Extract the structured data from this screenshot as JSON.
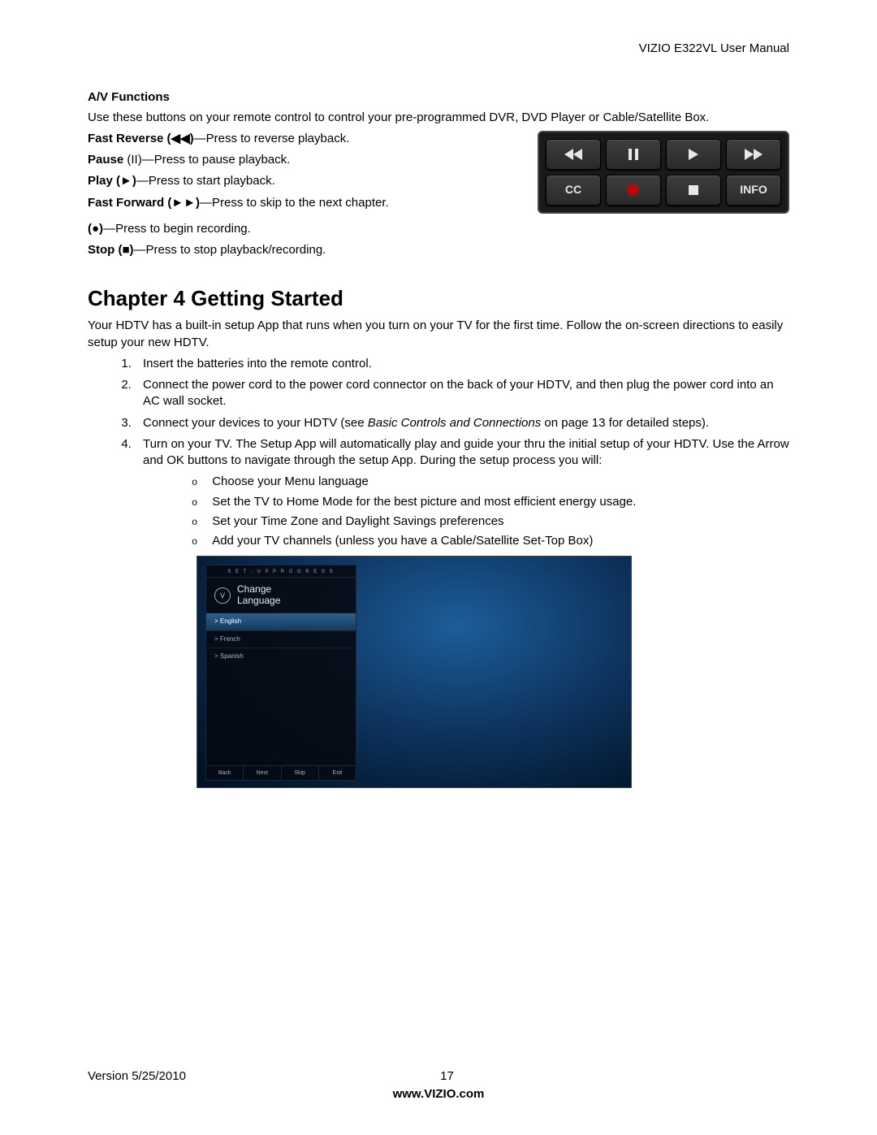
{
  "doc_title": "VIZIO E322VL User Manual",
  "av": {
    "heading": "A/V Functions",
    "intro": "Use these buttons on your remote control to control your pre-programmed DVR, DVD Player or Cable/Satellite Box.",
    "items": {
      "fr_label": "Fast Reverse (◀◀)",
      "fr_desc": "—Press to reverse playback.",
      "pause_label": "Pause",
      "pause_sym": " (II)",
      "pause_desc": "—Press to pause playback.",
      "play_label": "Play (►)",
      "play_desc": "—Press to start playback.",
      "ff_label": "Fast Forward (►►)",
      "ff_desc": "—Press to skip to the next chapter.",
      "rec_label": "(●)",
      "rec_desc": "—Press to begin recording.",
      "stop_label": "Stop (■)",
      "stop_desc": "—Press to stop playback/recording."
    }
  },
  "remote": {
    "cc": "CC",
    "info": "INFO"
  },
  "chapter": {
    "title": "Chapter 4 Getting Started",
    "intro": "Your HDTV has a built-in setup App that runs when you turn on your TV for the first time. Follow the on-screen directions to easily setup your new HDTV.",
    "steps": [
      "Insert the batteries into the remote control.",
      "Connect the power cord to the power cord connector on the back of your HDTV, and then plug the power cord into an AC wall socket.",
      "",
      "Turn on your TV. The Setup App will automatically play and guide your thru the initial setup of your HDTV. Use the Arrow and OK buttons to navigate through the setup App. During the setup process you will:"
    ],
    "step3_pre": "Connect your devices to your HDTV (see ",
    "step3_ref": "Basic Controls and Connections",
    "step3_post": " on page 13 for detailed steps).",
    "substeps": [
      "Choose your Menu language",
      "Set the TV to Home Mode for the best picture and most efficient energy usage.",
      "Set your Time Zone and Daylight Savings preferences",
      "Add your TV channels (unless you have a Cable/Satellite Set-Top Box)"
    ]
  },
  "setup_screenshot": {
    "progress_label": "S E T - U P   P R O G R E S S",
    "title_line1": "Change",
    "title_line2": "Language",
    "langs": {
      "en": "> English",
      "fr": "> French",
      "es": "> Spanish"
    },
    "footer": {
      "back": "Back",
      "next": "Next",
      "skip": "Skip",
      "exit": "Exit"
    }
  },
  "footer": {
    "version": "Version 5/25/2010",
    "page": "17",
    "url": "www.VIZIO.com"
  }
}
